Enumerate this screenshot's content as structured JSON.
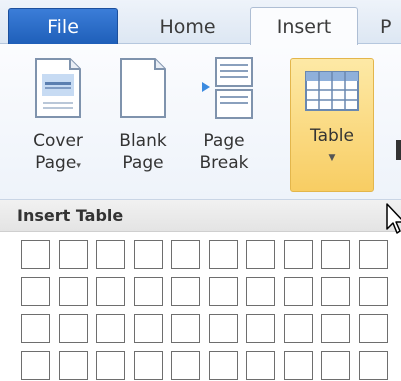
{
  "tabs": {
    "file": "File",
    "home": "Home",
    "insert": "Insert",
    "next": "P"
  },
  "ribbon": {
    "cover_page": {
      "line1": "Cover",
      "line2": "Page",
      "icon": "cover-page-icon"
    },
    "blank_page": {
      "line1": "Blank",
      "line2": "Page",
      "icon": "blank-page-icon"
    },
    "page_break": {
      "line1": "Page",
      "line2": "Break",
      "icon": "page-break-icon"
    },
    "table": {
      "label": "Table",
      "icon": "table-icon",
      "arrow": "▼"
    },
    "dropdown_arrow": "▾"
  },
  "insert_table": {
    "title": "Insert Table",
    "columns": 10,
    "rows": 4
  },
  "colors": {
    "file_tab": "#2a6bc8",
    "table_highlight": "#f8cd63"
  }
}
